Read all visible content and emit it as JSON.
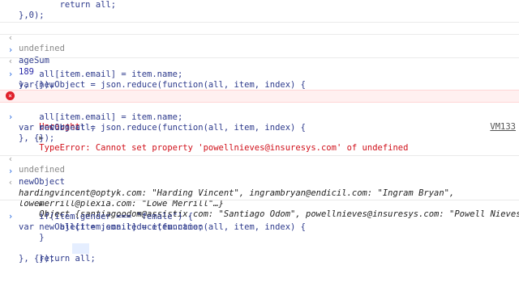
{
  "console": {
    "lines": [
      {
        "t": "        return all;"
      },
      {
        "t": "},0);"
      },
      {
        "t": "undefined"
      },
      {
        "t": "ageSum"
      },
      {
        "t": "189"
      },
      {
        "t": "var newObject = json.reduce(function(all, item, index) {"
      },
      {
        "t": "    all[item.email] = item.name;"
      },
      {
        "t": "}, {});"
      },
      {
        "t": "Uncaught ▸ TypeError: Cannot set property 'powellnieves@insuresys.com' of undefined"
      },
      {
        "t": "var newObject = json.reduce(function(all, item, index) {"
      },
      {
        "t": "    all[item.email] = item.name;"
      },
      {
        "t": "    return all;"
      },
      {
        "t": "}, {});"
      },
      {
        "t": "undefined"
      },
      {
        "t": "newObject"
      },
      {
        "t": "Object {santiagoodom@assistix.com: \"Santiago Odom\", powellnieves@insuresys.com: \"Powell Nieves\","
      },
      {
        "t": "hardingvincent@optyk.com: \"Harding Vincent\", ingrambryan@endicil.com: \"Ingram Bryan\","
      },
      {
        "t": "lowemerrill@plexia.com: \"Lowe Merrill\"…}"
      },
      {
        "t": "var newObject = json.reduce(function(all, item, index) {"
      },
      {
        "t": "    if(item.gender === \"female\") {"
      },
      {
        "t": "        all[item.email] = item.name;"
      },
      {
        "t": "    }"
      },
      {
        "t": "    return all;"
      },
      {
        "t": "}, {});"
      }
    ],
    "error_link": "VM133",
    "uncaught_label": "Uncaught",
    "error_text": "TypeError: Cannot set property 'powellnieves@insuresys.com' of undefined",
    "object_prefix": "Object",
    "colors": {
      "error": "#d0101a",
      "key": "#9a1a9a",
      "string": "#c41a16",
      "number": "#2a2aa8"
    }
  }
}
